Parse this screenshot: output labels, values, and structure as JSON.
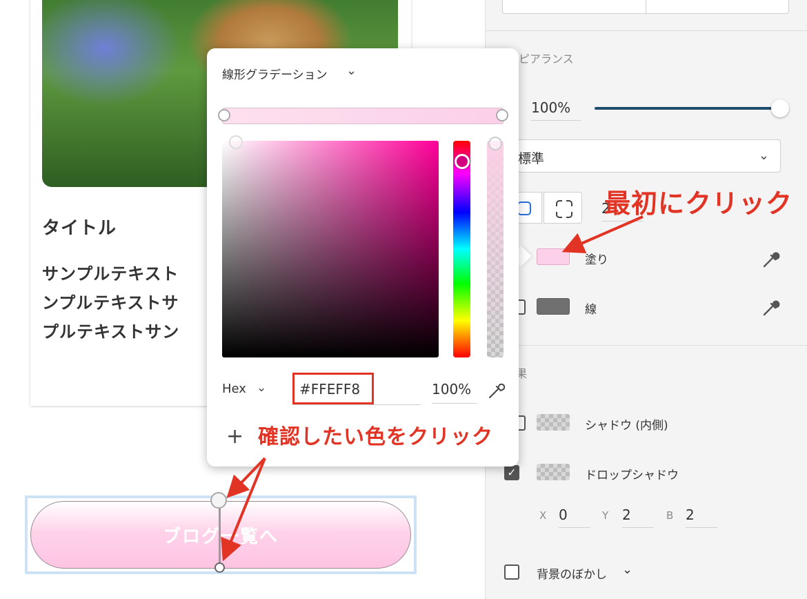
{
  "canvas": {
    "card": {
      "title": "タイトル",
      "body": "サンプルテキスト\nンプルテキストサ\nプルテキストサン"
    },
    "button_label": "ブログ一覧へ"
  },
  "color_picker": {
    "gradient_type": "線形グラデーション",
    "format_label": "Hex",
    "hex_value": "#FFEFF8",
    "opacity_value": "100%",
    "add_label": "+"
  },
  "panel": {
    "appearance_label": "ピアランス",
    "opacity_value": "100%",
    "opacity_fraction": 1.0,
    "blend_mode": "標準",
    "corner_value": "2",
    "fill_label": "塗り",
    "stroke_label": "線",
    "effects_label": "果",
    "effects": [
      {
        "label": "シャドウ (内側)",
        "checked": false
      },
      {
        "label": "ドロップシャドウ",
        "checked": true
      }
    ],
    "shadow_x_label": "X",
    "shadow_x": "0",
    "shadow_y_label": "Y",
    "shadow_y": "2",
    "shadow_b_label": "B",
    "shadow_b": "2",
    "background_blur_label": "背景のぼかし"
  },
  "annotations": {
    "first_click": "最初にクリック",
    "click_color": "確認したい色をクリック"
  },
  "colors": {
    "accent_red": "#e23424",
    "fill_swatch": "#fcd0e8",
    "stroke_swatch": "#707070",
    "slider_track": "#1e4c6c"
  }
}
